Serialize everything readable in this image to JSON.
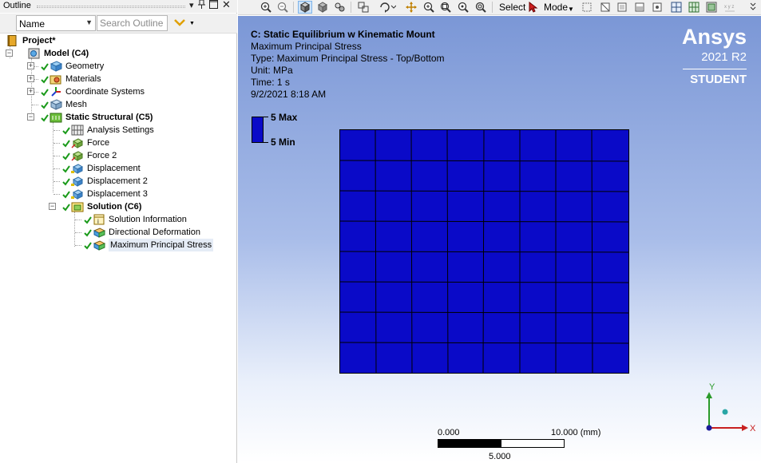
{
  "outline": {
    "title": "Outline",
    "controls": {
      "dropdown": "▾",
      "pin": "📌",
      "restore": "☐",
      "close": "✕"
    },
    "filter": {
      "name_value": "Name",
      "search_placeholder": "Search Outline"
    }
  },
  "tree": {
    "project": "Project*",
    "model": "Model (C4)",
    "geometry": "Geometry",
    "materials": "Materials",
    "coordinate_systems": "Coordinate Systems",
    "mesh": "Mesh",
    "static_structural": "Static Structural (C5)",
    "analysis_settings": "Analysis Settings",
    "force": "Force",
    "force2": "Force 2",
    "displacement": "Displacement",
    "displacement2": "Displacement 2",
    "displacement3": "Displacement 3",
    "solution": "Solution (C6)",
    "solution_information": "Solution Information",
    "directional_deformation": "Directional Deformation",
    "max_principal_stress": "Maximum Principal Stress"
  },
  "toolbar": {
    "select_label": "Select",
    "mode_label": "Mode"
  },
  "viewport": {
    "info": {
      "title": "C: Static Equilibrium w Kinematic Mount",
      "line1": "Maximum Principal Stress",
      "line2": "Type: Maximum Principal Stress - Top/Bottom",
      "line3": "Unit: MPa",
      "line4": "Time: 1 s",
      "line5": "9/2/2021 8:18 AM"
    },
    "legend": {
      "max": "5 Max",
      "min": "5 Min",
      "color": "#0a0ac8"
    },
    "logo": {
      "brand": "Ansys",
      "version": "2021 R2",
      "edition": "STUDENT"
    },
    "scale": {
      "left": "0.000",
      "right": "10.000 (mm)",
      "mid": "5.000"
    },
    "triad": {
      "y": "Y",
      "x": "X"
    },
    "mesh_color": "#0a0ac8"
  }
}
